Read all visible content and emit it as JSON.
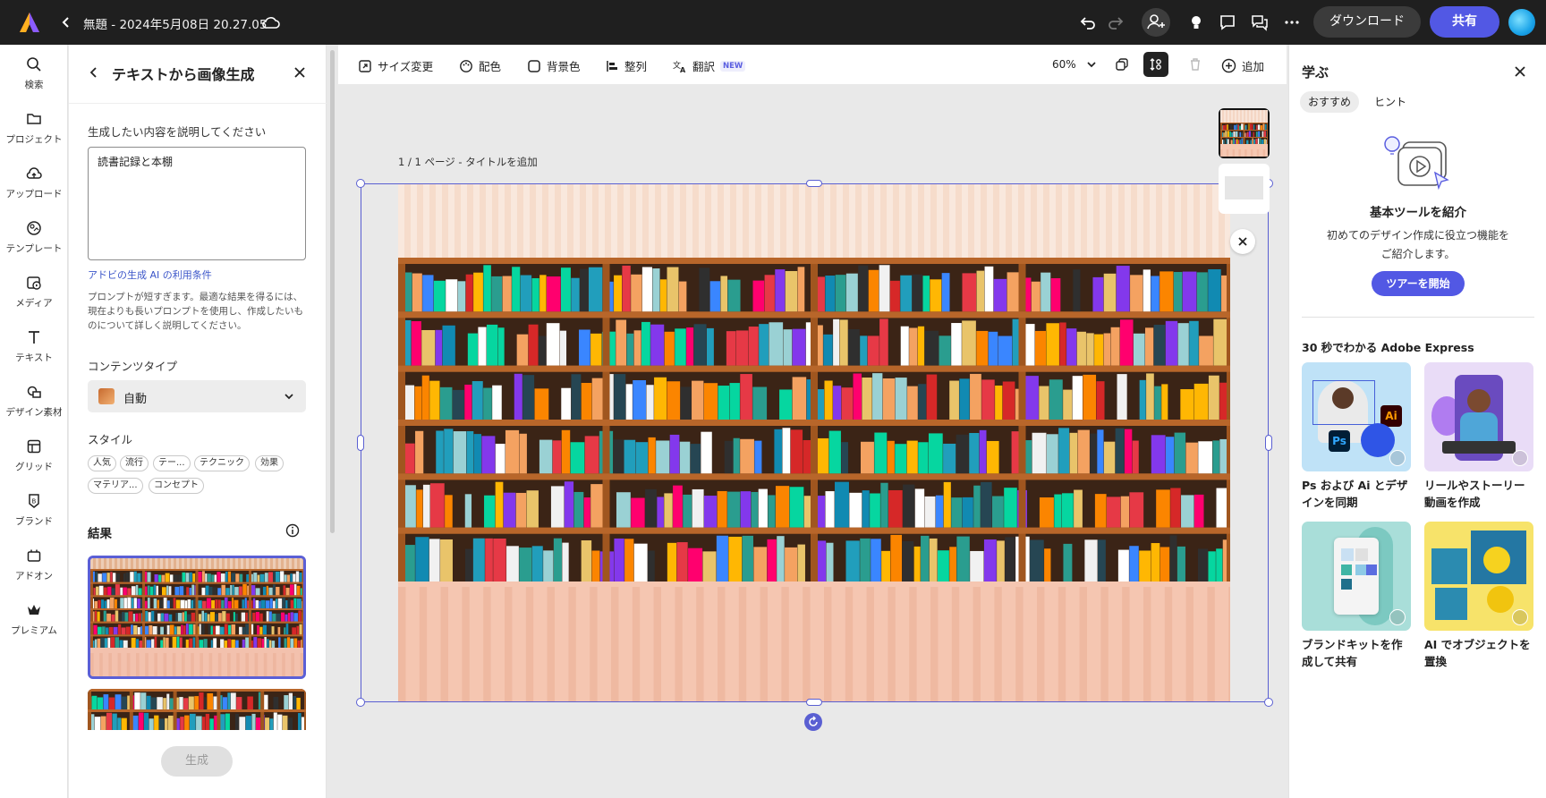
{
  "topbar": {
    "doc_title": "無題 - 2024年5月08日 20.27.05",
    "download_label": "ダウンロード",
    "share_label": "共有"
  },
  "rail": {
    "items": [
      {
        "label": "検索",
        "icon": "search-icon"
      },
      {
        "label": "プロジェクト",
        "icon": "folder-icon"
      },
      {
        "label": "アップロード",
        "icon": "upload-icon"
      },
      {
        "label": "テンプレート",
        "icon": "template-icon"
      },
      {
        "label": "メディア",
        "icon": "media-icon"
      },
      {
        "label": "テキスト",
        "icon": "text-icon"
      },
      {
        "label": "デザイン素材",
        "icon": "design-assets-icon"
      },
      {
        "label": "グリッド",
        "icon": "grid-icon"
      },
      {
        "label": "ブランド",
        "icon": "brand-icon"
      },
      {
        "label": "アドオン",
        "icon": "addon-icon"
      },
      {
        "label": "プレミアム",
        "icon": "crown-icon"
      }
    ]
  },
  "gen_panel": {
    "title": "テキストから画像生成",
    "prompt_label": "生成したい内容を説明してください",
    "prompt_value": "読書記録と本棚",
    "terms_link": "アドビの生成 AI の利用条件",
    "hint": "プロンプトが短すぎます。最適な結果を得るには、現在よりも長いプロンプトを使用し、作成したいものについて詳しく説明してください。",
    "content_type_label": "コンテンツタイプ",
    "content_type_value": "自動",
    "style_label": "スタイル",
    "style_chips": [
      "人気",
      "流行",
      "テー...",
      "テクニック",
      "効果",
      "マテリア...",
      "コンセプト"
    ],
    "results_label": "結果",
    "generate_label": "生成"
  },
  "toolbar": {
    "resize": "サイズ変更",
    "colors": "配色",
    "background": "背景色",
    "align": "整列",
    "translate": "翻訳",
    "new_badge": "NEW",
    "zoom": "60%",
    "add": "追加"
  },
  "canvas": {
    "page_label": "1 / 1 ページ - タイトルを追加"
  },
  "learn": {
    "title": "学ぶ",
    "tabs": [
      "おすすめ",
      "ヒント"
    ],
    "intro_title": "基本ツールを紹介",
    "intro_desc": "初めてのデザイン作成に役立つ機能をご紹介します。",
    "tour_button": "ツアーを開始",
    "section_title": "30 秒でわかる Adobe Express",
    "cards": [
      {
        "caption": "Ps および Ai とデザインを同期"
      },
      {
        "caption": "リールやストーリー動画を作成"
      },
      {
        "caption": "ブランドキットを作成して共有"
      },
      {
        "caption": "AI でオブジェクトを置換"
      }
    ]
  },
  "colors": {
    "accent": "#5258e4",
    "selection": "#5a5fd2",
    "topbar_bg": "#1f1f1f"
  }
}
